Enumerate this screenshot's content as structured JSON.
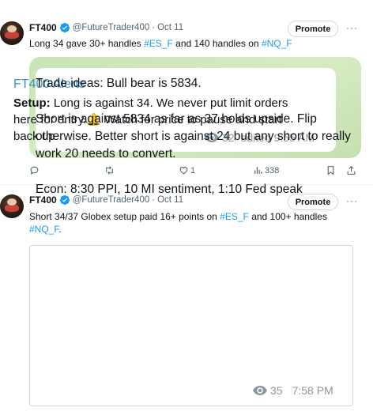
{
  "tweet1": {
    "author_name": "FT400",
    "handle": "@FutureTrader400",
    "date": "Oct 11",
    "promote_label": "Promote",
    "text_parts": [
      "Long 34 gave 30+ handles ",
      "#ES_F",
      " and 140 handles on ",
      "#NQ_F"
    ],
    "card": {
      "title": "FT400 Alerts",
      "setup_label": "Setup:",
      "body_a": " Long is against 34.  We never put limit orders here for entry.",
      "bell": "🔔",
      "body_b": " Watch for price to pause and start back up",
      "views": "32",
      "edited": "edited 9:55 AM"
    },
    "actions": {
      "replies": "",
      "retweets": "",
      "likes": "1",
      "views": "338"
    }
  },
  "tweet2": {
    "author_name": "FT400",
    "handle": "@FutureTrader400",
    "date": "Oct 11",
    "promote_label": "Promote",
    "text_parts": [
      "Short 34/37 Globex setup  paid 16+ points on ",
      "#ES_F",
      " and 100+ handles ",
      "#NQ_F",
      "."
    ],
    "card": {
      "line1": "Trade ideas:  Bull bear is 5834.",
      "line2": "Short is against 5834 as far as 37 holds upside. Flip otherwise. Better short is against 24 but any short to really work 20 needs to convert.",
      "line3": "Econ: 8:30 PPI, 10 MI sentiment, 1:10 Fed speak",
      "views": "35",
      "time": "7:58 PM"
    }
  },
  "colors": {
    "hashtag": "#1d9bf0",
    "verified": "#1d9bf0",
    "card_green": "#d0e8bd",
    "alerts_title": "#3a92c4"
  }
}
